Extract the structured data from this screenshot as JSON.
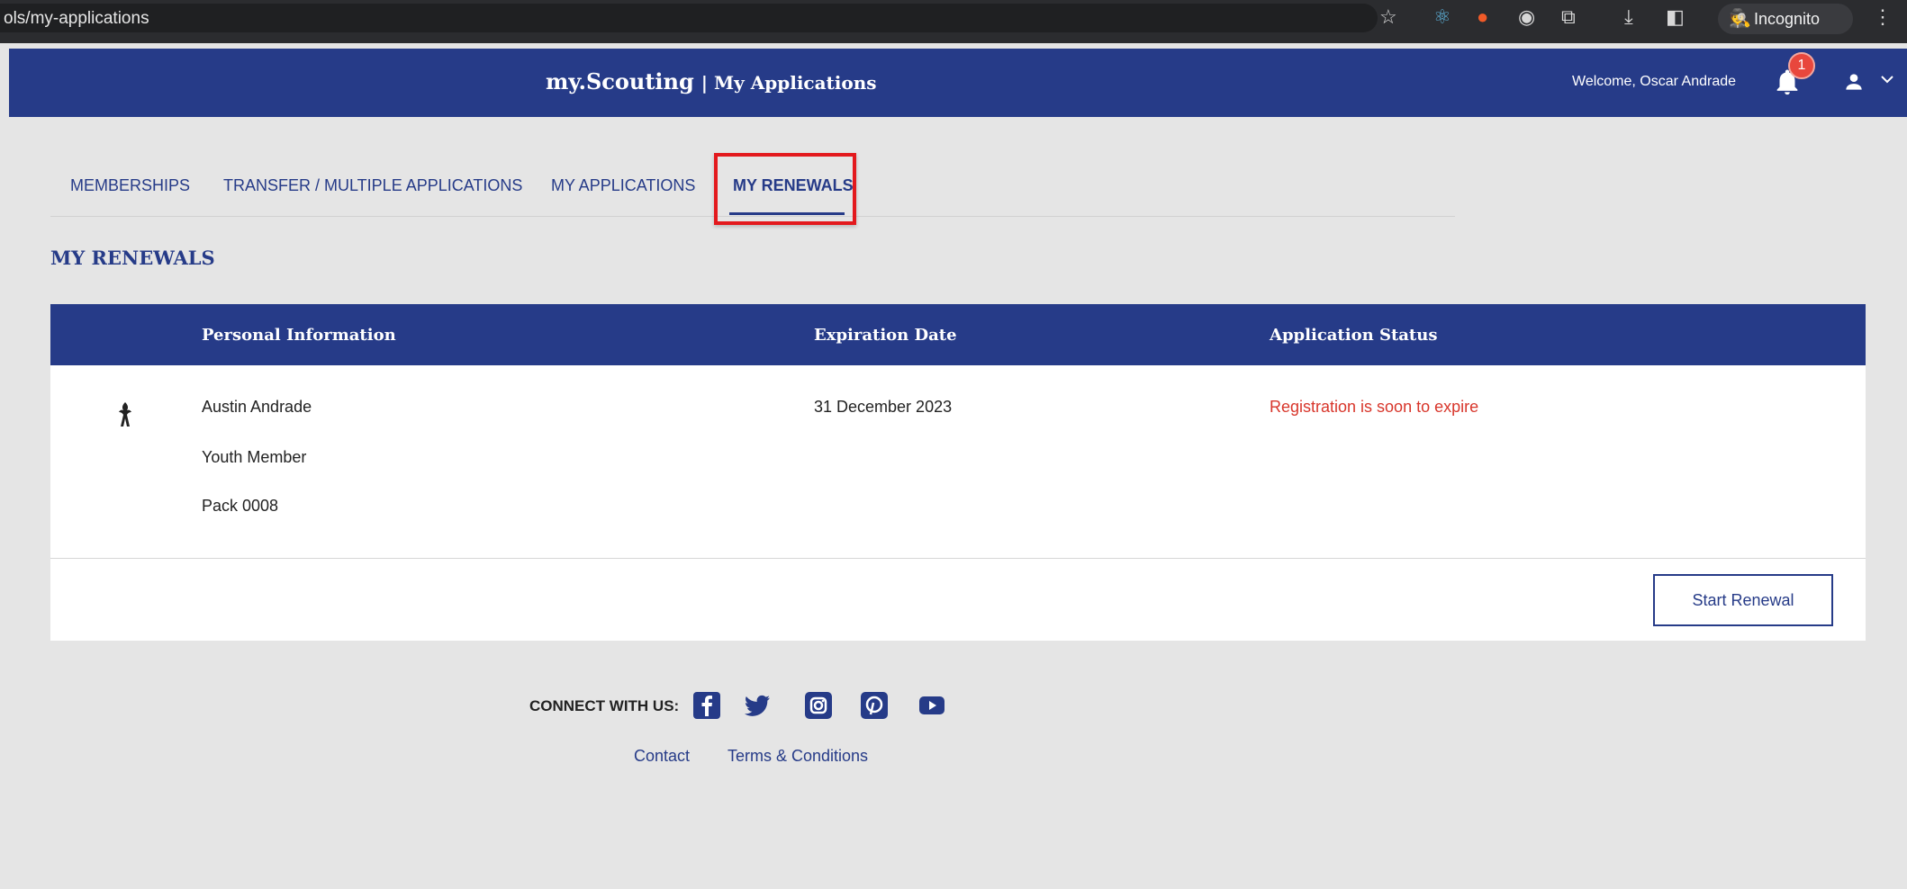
{
  "browser": {
    "url": "ols/my-applications",
    "incognito_label": "Incognito"
  },
  "header": {
    "brand": "my.Scouting",
    "section": "| My Applications",
    "welcome": "Welcome, Oscar Andrade",
    "notification_count": "1"
  },
  "tabs": [
    {
      "label": "MEMBERSHIPS"
    },
    {
      "label": "TRANSFER / MULTIPLE APPLICATIONS"
    },
    {
      "label": "MY APPLICATIONS"
    },
    {
      "label": "MY RENEWALS"
    }
  ],
  "page": {
    "title": "MY RENEWALS"
  },
  "table": {
    "headers": [
      "Personal Information",
      "Expiration Date",
      "Application Status"
    ],
    "rows": [
      {
        "name": "Austin Andrade",
        "role": "Youth Member",
        "unit": "Pack 0008",
        "expiration": "31 December 2023",
        "status": "Registration is soon to expire"
      }
    ],
    "action_label": "Start Renewal"
  },
  "footer": {
    "connect_label": "CONNECT WITH US:",
    "links": [
      "Contact",
      "Terms & Conditions"
    ]
  },
  "colors": {
    "primary": "#263b88",
    "status_warning": "#d8362b",
    "highlight": "#e3191d"
  }
}
